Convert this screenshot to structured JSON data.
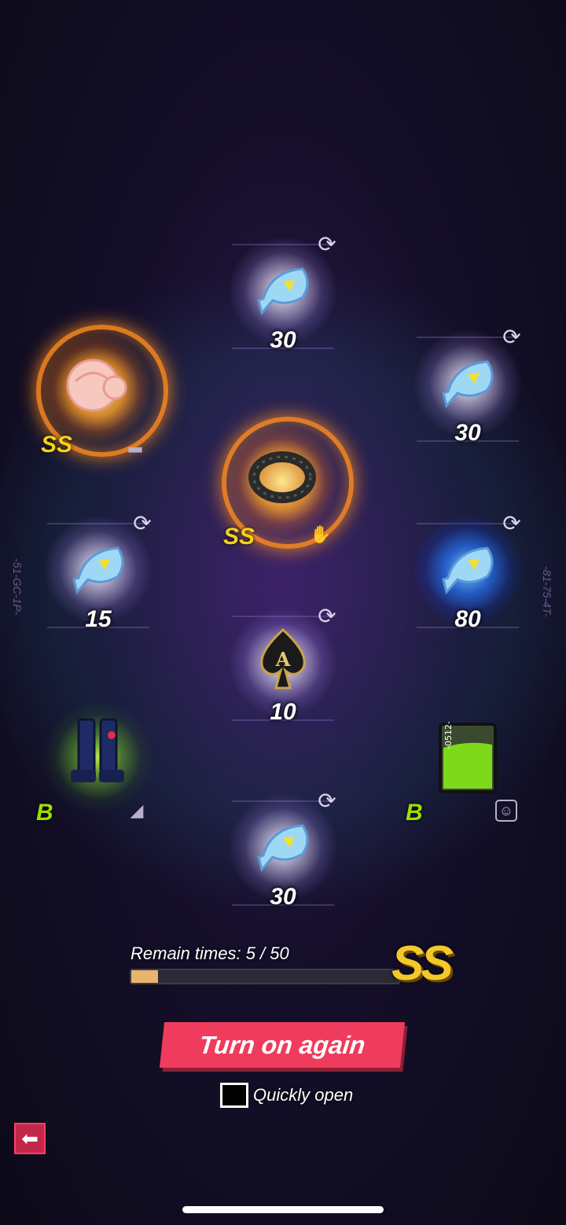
{
  "side_codes": {
    "left": "-51-GC-1P-",
    "right": "-81-75-4T-"
  },
  "slots": [
    {
      "id": "top-fish",
      "qty": "30",
      "grade": "",
      "item": "fish-token-icon",
      "refresh": true
    },
    {
      "id": "wig",
      "qty": "",
      "grade": "SS",
      "item": "wig-icon",
      "refresh": false,
      "type_icon": "hat-icon"
    },
    {
      "id": "right-fish",
      "qty": "30",
      "grade": "",
      "item": "fish-token-icon",
      "refresh": true
    },
    {
      "id": "ring",
      "qty": "",
      "grade": "SS",
      "item": "spiked-bracelet-icon",
      "refresh": false,
      "type_icon": "glove-icon"
    },
    {
      "id": "left-fish",
      "qty": "15",
      "grade": "",
      "item": "fish-token-icon",
      "refresh": true
    },
    {
      "id": "blue-fish",
      "qty": "80",
      "grade": "",
      "item": "fish-token-icon",
      "refresh": true
    },
    {
      "id": "ace",
      "qty": "10",
      "grade": "",
      "item": "spade-ace-icon",
      "refresh": true
    },
    {
      "id": "boots",
      "qty": "",
      "grade": "B",
      "item": "boots-icon",
      "refresh": false,
      "type_icon": "shoe-icon"
    },
    {
      "id": "jar",
      "qty": "",
      "grade": "B",
      "item": "green-jar-icon",
      "refresh": false,
      "type_icon": "portrait-icon"
    },
    {
      "id": "bottom-fish",
      "qty": "30",
      "grade": "",
      "item": "fish-token-icon",
      "refresh": true
    }
  ],
  "jar_label": "-0512-",
  "progress": {
    "label": "Remain times: 5 / 50",
    "current": 5,
    "total": 50,
    "grade": "SS"
  },
  "actions": {
    "again_label": "Turn on again",
    "quick_label": "Quickly open",
    "quick_checked": false
  },
  "colors": {
    "button": "#ef3b5d",
    "grade_ss": "#f1d21e",
    "grade_b": "#9be000",
    "progress_fill": "#e7b56c"
  }
}
